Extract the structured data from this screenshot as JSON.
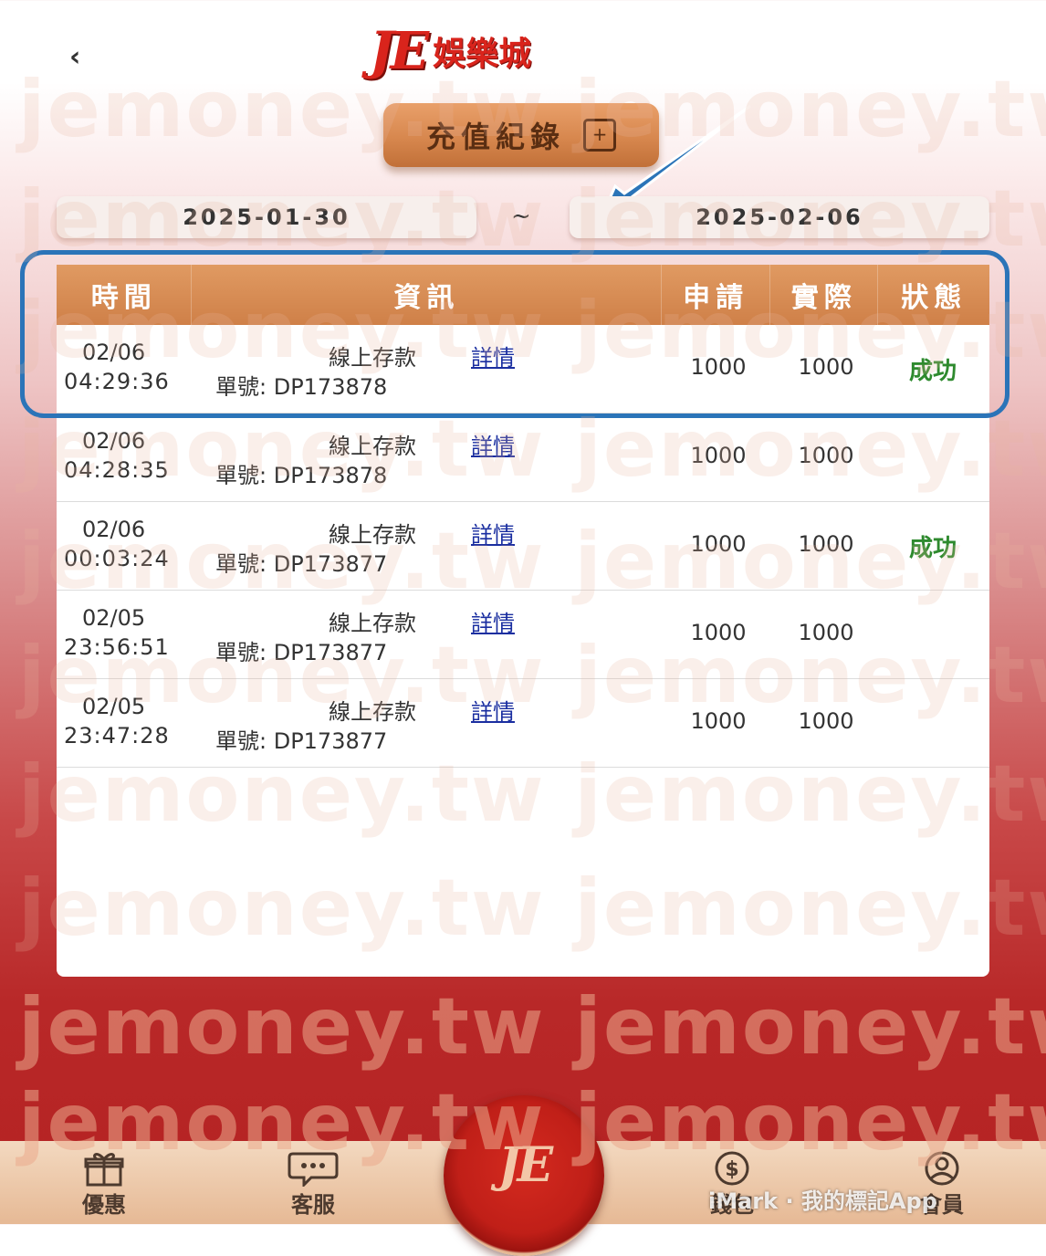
{
  "header": {
    "back_icon": "chevron-left-icon",
    "logo_text": "JE",
    "logo_subtitle": "娛樂城",
    "title": "充值紀錄"
  },
  "filter": {
    "date_from": "2025-01-30",
    "separator": "~",
    "date_to": "2025-02-06"
  },
  "table": {
    "headers": [
      "時間",
      "資訊",
      "申請",
      "實際",
      "狀態"
    ],
    "rows": [
      {
        "date": "02/06",
        "time": "04:29:36",
        "type": "線上存款",
        "detail": "詳情",
        "order": "單號: DP173878",
        "apply": "1000",
        "actual": "1000",
        "status": "成功"
      },
      {
        "date": "02/06",
        "time": "04:28:35",
        "type": "線上存款",
        "detail": "詳情",
        "order": "單號: DP173878",
        "apply": "1000",
        "actual": "1000",
        "status": ""
      },
      {
        "date": "02/06",
        "time": "00:03:24",
        "type": "線上存款",
        "detail": "詳情",
        "order": "單號: DP173877",
        "apply": "1000",
        "actual": "1000",
        "status": "成功"
      },
      {
        "date": "02/05",
        "time": "23:56:51",
        "type": "線上存款",
        "detail": "詳情",
        "order": "單號: DP173877",
        "apply": "1000",
        "actual": "1000",
        "status": ""
      },
      {
        "date": "02/05",
        "time": "23:47:28",
        "type": "線上存款",
        "detail": "詳情",
        "order": "單號: DP173877",
        "apply": "1000",
        "actual": "1000",
        "status": ""
      }
    ]
  },
  "nav": {
    "items": [
      {
        "label": "優惠",
        "icon": "gift-icon"
      },
      {
        "label": "客服",
        "icon": "chat-icon"
      },
      {
        "label": "錢包",
        "icon": "wallet-icon"
      },
      {
        "label": "會員",
        "icon": "user-icon"
      }
    ],
    "center_logo": "JE"
  },
  "watermark": "jemoney.tw jemoney.tw",
  "overlay_brand": "iMark · 我的標記App",
  "colors": {
    "brand_red": "#d9241c",
    "header_orange": "#cf8048",
    "success_green": "#2e8a2e",
    "link_blue": "#1a2ea0",
    "highlight_blue": "#2b74b8"
  }
}
